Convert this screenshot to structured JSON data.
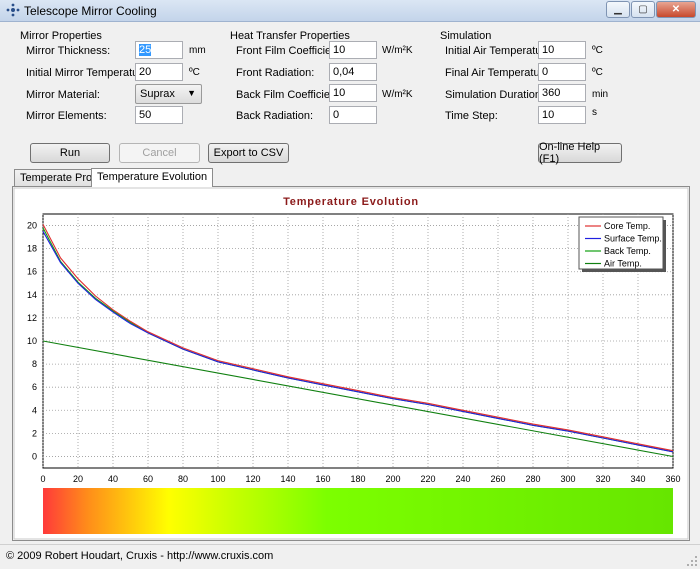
{
  "window": {
    "title": "Telescope Mirror Cooling",
    "controls": [
      "minimize",
      "maximize",
      "close"
    ]
  },
  "mirror_properties": {
    "title": "Mirror Properties",
    "thickness_label": "Mirror Thickness:",
    "thickness_value": "25",
    "thickness_unit": "mm",
    "initial_temp_label": "Initial Mirror Temperature:",
    "initial_temp_value": "20",
    "initial_temp_unit": "ºC",
    "material_label": "Mirror Material:",
    "material_value": "Suprax",
    "elements_label": "Mirror Elements:",
    "elements_value": "50"
  },
  "heat_transfer": {
    "title": "Heat Transfer Properties",
    "front_film_label": "Front Film Coefficient:",
    "front_film_value": "10",
    "front_film_unit": "W/m²K",
    "front_radiation_label": "Front Radiation:",
    "front_radiation_value": "0,04",
    "back_film_label": "Back Film Coefficient:",
    "back_film_value": "10",
    "back_film_unit": "W/m²K",
    "back_radiation_label": "Back Radiation:",
    "back_radiation_value": "0"
  },
  "simulation": {
    "title": "Simulation",
    "initial_air_label": "Initial Air Temperature:",
    "initial_air_value": "10",
    "initial_air_unit": "ºC",
    "final_air_label": "Final Air Temperature:",
    "final_air_value": "0",
    "final_air_unit": "ºC",
    "duration_label": "Simulation Duration:",
    "duration_value": "360",
    "duration_unit": "min",
    "time_step_label": "Time Step:",
    "time_step_value": "10",
    "time_step_unit": "s"
  },
  "buttons": {
    "run": "Run",
    "cancel": "Cancel",
    "export": "Export to CSV",
    "help": "On-line Help (F1)"
  },
  "tabs": [
    {
      "label": "Temperate Profile",
      "active": false
    },
    {
      "label": "Temperature Evolution",
      "active": true
    }
  ],
  "colors": {
    "title": "#8b1a1a",
    "core": "#e03030",
    "surface": "#2020e0",
    "back": "#10a010",
    "air": "#108010",
    "gradient": [
      "#ff3a3a",
      "#ff8c1a",
      "#ffff00",
      "#c8ff00",
      "#7cff00",
      "#66e600"
    ]
  },
  "chart_data": {
    "type": "line",
    "title": "Temperature Evolution",
    "xlim": [
      0,
      360
    ],
    "ylim": [
      -1,
      21
    ],
    "xticks": [
      0,
      20,
      40,
      60,
      80,
      100,
      120,
      140,
      160,
      180,
      200,
      220,
      240,
      260,
      280,
      300,
      320,
      340,
      360
    ],
    "yticks": [
      0,
      2,
      4,
      6,
      8,
      10,
      12,
      14,
      16,
      18,
      20
    ],
    "grid": true,
    "legend_position": "top-right",
    "series": [
      {
        "name": "Core Temp.",
        "x": [
          0,
          10,
          20,
          30,
          40,
          50,
          60,
          80,
          100,
          120,
          140,
          160,
          180,
          200,
          220,
          240,
          260,
          280,
          300,
          320,
          340,
          360
        ],
        "y": [
          20.1,
          17.2,
          15.4,
          13.9,
          12.7,
          11.7,
          10.8,
          9.4,
          8.3,
          7.6,
          6.9,
          6.3,
          5.7,
          5.1,
          4.6,
          4.0,
          3.4,
          2.8,
          2.3,
          1.7,
          1.1,
          0.5
        ]
      },
      {
        "name": "Surface Temp.",
        "x": [
          0,
          10,
          20,
          30,
          40,
          50,
          60,
          80,
          100,
          120,
          140,
          160,
          180,
          200,
          220,
          240,
          260,
          280,
          300,
          320,
          340,
          360
        ],
        "y": [
          19.5,
          16.8,
          15.0,
          13.6,
          12.5,
          11.5,
          10.7,
          9.3,
          8.2,
          7.5,
          6.8,
          6.2,
          5.6,
          5.0,
          4.5,
          3.9,
          3.3,
          2.7,
          2.2,
          1.6,
          1.0,
          0.4
        ]
      },
      {
        "name": "Back Temp.",
        "x": [
          0,
          10,
          20,
          30,
          40,
          50,
          60,
          80,
          100,
          120,
          140,
          160,
          180,
          200,
          220,
          240,
          260,
          280,
          300,
          320,
          340,
          360
        ],
        "y": [
          19.8,
          16.9,
          15.1,
          13.7,
          12.6,
          11.6,
          10.7,
          9.3,
          8.2,
          7.5,
          6.8,
          6.2,
          5.6,
          5.0,
          4.5,
          3.9,
          3.3,
          2.7,
          2.2,
          1.6,
          1.0,
          0.4
        ]
      },
      {
        "name": "Air Temp.",
        "x": [
          0,
          360
        ],
        "y": [
          10,
          0
        ]
      }
    ]
  },
  "status": "© 2009 Robert Houdart, Cruxis  -  http://www.cruxis.com"
}
